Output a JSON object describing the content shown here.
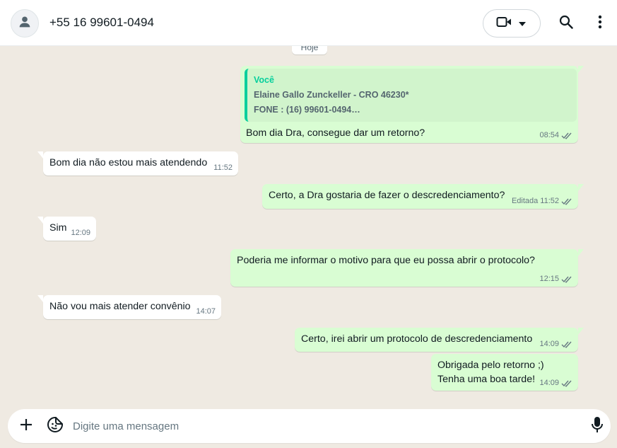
{
  "header": {
    "contact_name": "+55 16 99601-0494",
    "avatar_icon": "person-icon",
    "video_icon": "video-camera-icon",
    "dropdown_icon": "chevron-down-icon",
    "search_icon": "search-icon",
    "menu_icon": "more-vertical-icon"
  },
  "chat": {
    "date_label": "Hoje",
    "messages": [
      {
        "direction": "out",
        "quote": {
          "author": "Você",
          "line1": "Elaine Gallo Zunckeller - CRO 46230*",
          "line2": "FONE : (16) 99601-0494…"
        },
        "text": "Bom dia Dra, consegue dar um retorno?",
        "time": "08:54",
        "status": "read"
      },
      {
        "direction": "in",
        "text": "Bom dia não estou mais atendendo",
        "time": "11:52"
      },
      {
        "direction": "out",
        "text": "Certo, a Dra gostaria de fazer o descredenciamento?",
        "edited": "Editada",
        "time": "11:52",
        "status": "read"
      },
      {
        "direction": "in",
        "text": "Sim",
        "time": "12:09"
      },
      {
        "direction": "out",
        "text": "Poderia me informar o motivo para que eu possa abrir o protocolo?",
        "time": "12:15",
        "status": "read"
      },
      {
        "direction": "in",
        "text": "Não vou mais atender convênio",
        "time": "14:07"
      },
      {
        "direction": "out",
        "text": "Certo, irei abrir um protocolo de descredenciamento",
        "time": "14:09",
        "status": "read"
      },
      {
        "direction": "out",
        "line1": "Obrigada pelo retorno ;)",
        "line2": "Tenha uma boa tarde!",
        "time": "14:09",
        "status": "read"
      }
    ]
  },
  "composer": {
    "placeholder": "Digite uma mensagem",
    "plus_icon": "plus-icon",
    "sticker_icon": "sticker-icon",
    "mic_icon": "microphone-icon"
  },
  "colors": {
    "outgoing_bubble": "#d9fdd3",
    "incoming_bubble": "#ffffff",
    "accent": "#06cf9c",
    "read_ticks": "#667781"
  }
}
